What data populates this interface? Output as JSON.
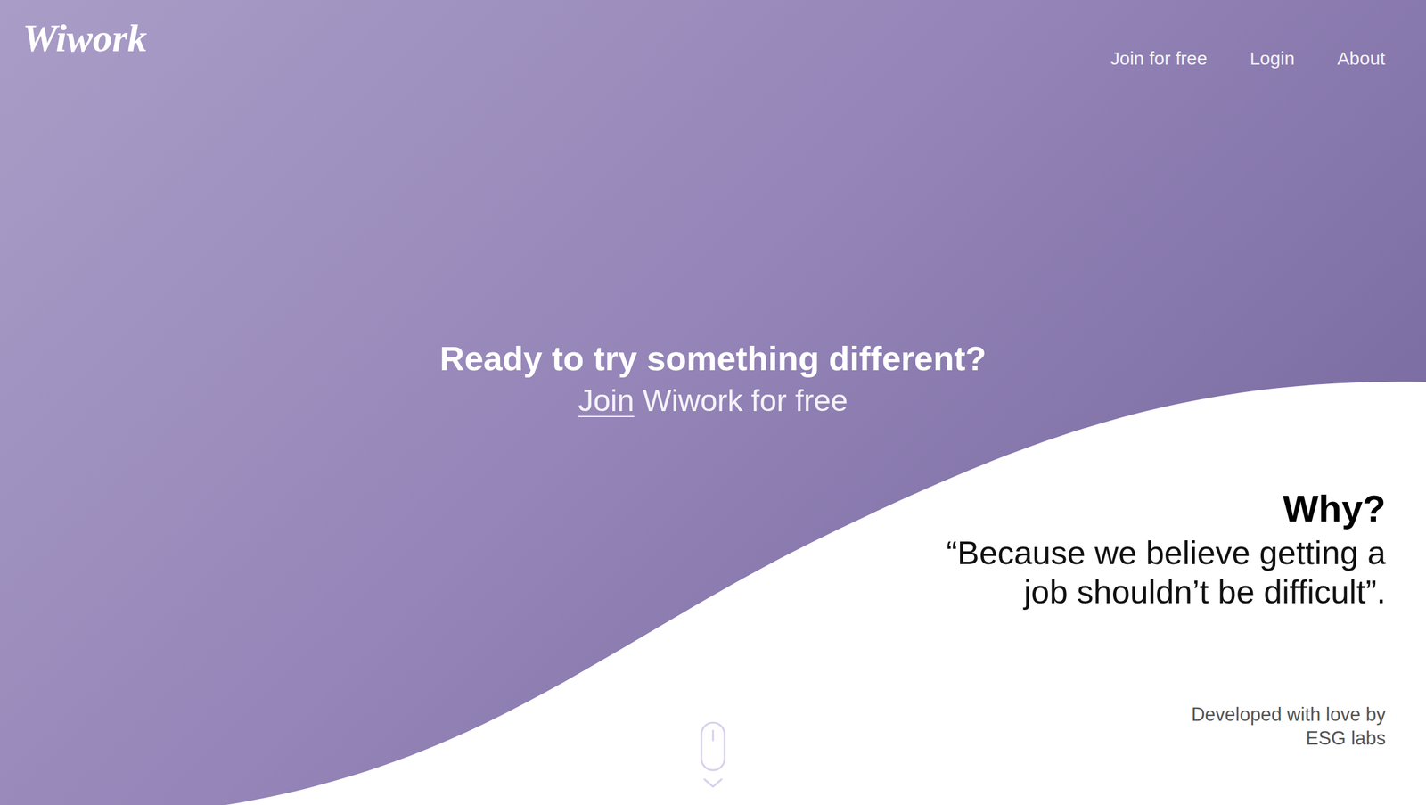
{
  "logo": "Wiwork",
  "nav": [
    {
      "label": "Join for free"
    },
    {
      "label": "Login"
    },
    {
      "label": "About"
    }
  ],
  "hero": {
    "title": "Ready to try something different?",
    "cta_link": "Join",
    "cta_rest": "Wiwork for free"
  },
  "why": {
    "title": "Why?",
    "quote_lines": [
      "“Because we believe getting a",
      "job shouldn’t be difficult”."
    ]
  },
  "credit": [
    "Developed with love by",
    "ESG labs"
  ]
}
